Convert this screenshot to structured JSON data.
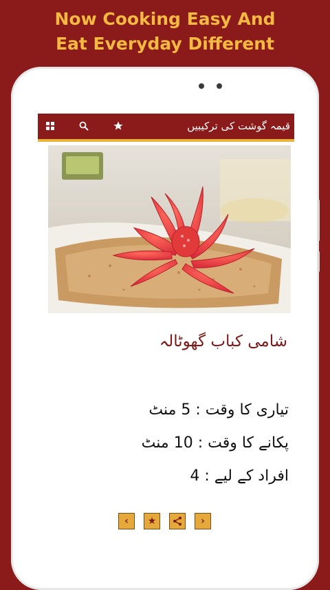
{
  "promo": {
    "line1": "Now Cooking Easy And",
    "line2": "Eat Everyday Different"
  },
  "app": {
    "title": "قیمہ گوشت کی ترکیبیں",
    "toolbar_icons": [
      "grid-icon",
      "search-icon",
      "star-icon"
    ]
  },
  "recipe": {
    "name": "شامی کباب گھوٹالہ",
    "prep_time": "تیاری کا وقت : 5 منٹ",
    "cook_time": "پکانے کا وقت : 10 منٹ",
    "servings": "افراد کے لیے : 4"
  },
  "nav": {
    "prev": "‹",
    "favorite": "★",
    "share": "<",
    "next": "›"
  },
  "colors": {
    "background": "#8b1a1a",
    "headline": "#f4b942",
    "toolbar": "#8b1a1a",
    "accent": "#e7b33a",
    "recipe_title": "#7a1a1a"
  }
}
